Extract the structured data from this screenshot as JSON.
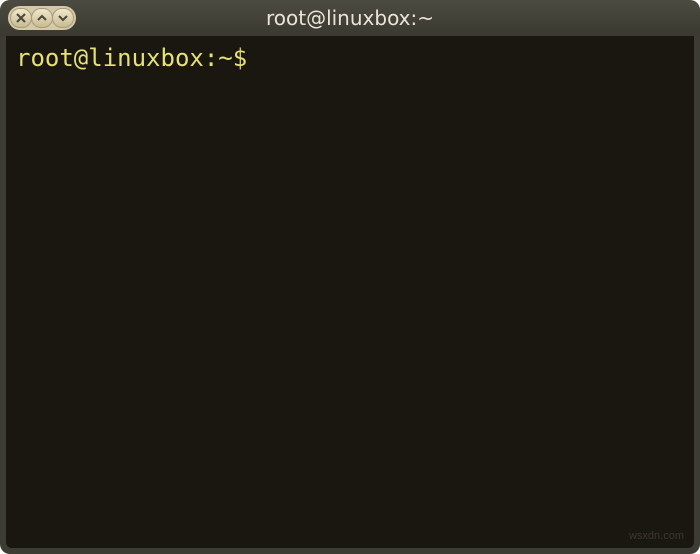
{
  "window": {
    "title": "root@linuxbox:~"
  },
  "controls": {
    "close_label": "X",
    "up_label": "^",
    "down_label": "v"
  },
  "terminal": {
    "prompt": "root@linuxbox:~$ ",
    "input": ""
  },
  "watermark": "wsxdn.com"
}
